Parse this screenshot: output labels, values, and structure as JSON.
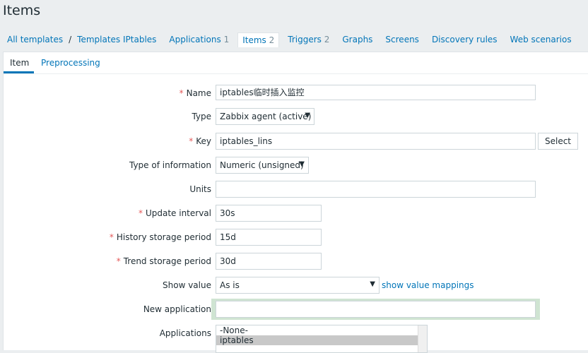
{
  "page": {
    "title": "Items"
  },
  "breadcrumb": {
    "all_templates": "All templates",
    "separator": "/",
    "template": "Templates IPtables"
  },
  "nav": {
    "applications": {
      "label": "Applications",
      "count": "1"
    },
    "items": {
      "label": "Items",
      "count": "2"
    },
    "triggers": {
      "label": "Triggers",
      "count": "2"
    },
    "graphs": {
      "label": "Graphs"
    },
    "screens": {
      "label": "Screens"
    },
    "discovery": {
      "label": "Discovery rules"
    },
    "web": {
      "label": "Web scenarios"
    }
  },
  "tabs": {
    "item": "Item",
    "preprocessing": "Preprocessing"
  },
  "form": {
    "required_mark": "*",
    "name": {
      "label": "Name",
      "value": "iptables临时插入监控"
    },
    "type": {
      "label": "Type",
      "value": "Zabbix agent (active)"
    },
    "key": {
      "label": "Key",
      "value": "iptables_lins",
      "button": "Select"
    },
    "type_of_info": {
      "label": "Type of information",
      "value": "Numeric (unsigned)"
    },
    "units": {
      "label": "Units",
      "value": ""
    },
    "update_interval": {
      "label": "Update interval",
      "value": "30s"
    },
    "history": {
      "label": "History storage period",
      "value": "15d"
    },
    "trend": {
      "label": "Trend storage period",
      "value": "30d"
    },
    "show_value": {
      "label": "Show value",
      "value": "As is",
      "link": "show value mappings"
    },
    "new_application": {
      "label": "New application",
      "value": ""
    },
    "applications": {
      "label": "Applications",
      "options": [
        "-None-",
        "iptables"
      ]
    }
  },
  "colors": {
    "link": "#0275b8",
    "required": "#e45959",
    "focus": "#cfe4d2"
  }
}
